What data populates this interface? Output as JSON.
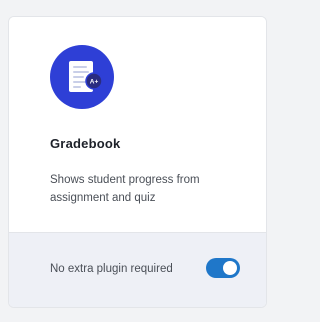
{
  "card": {
    "title": "Gradebook",
    "description": "Shows student progress from assignment and quiz",
    "icon": "gradebook-document-icon",
    "icon_badge": "A+",
    "footer_text": "No extra plugin required",
    "toggle_enabled": true
  },
  "colors": {
    "page_background": "#f2f3f5",
    "icon_circle": "#2e3fd6",
    "footer_background": "#eef0f6",
    "toggle_on": "#1f77c9"
  }
}
